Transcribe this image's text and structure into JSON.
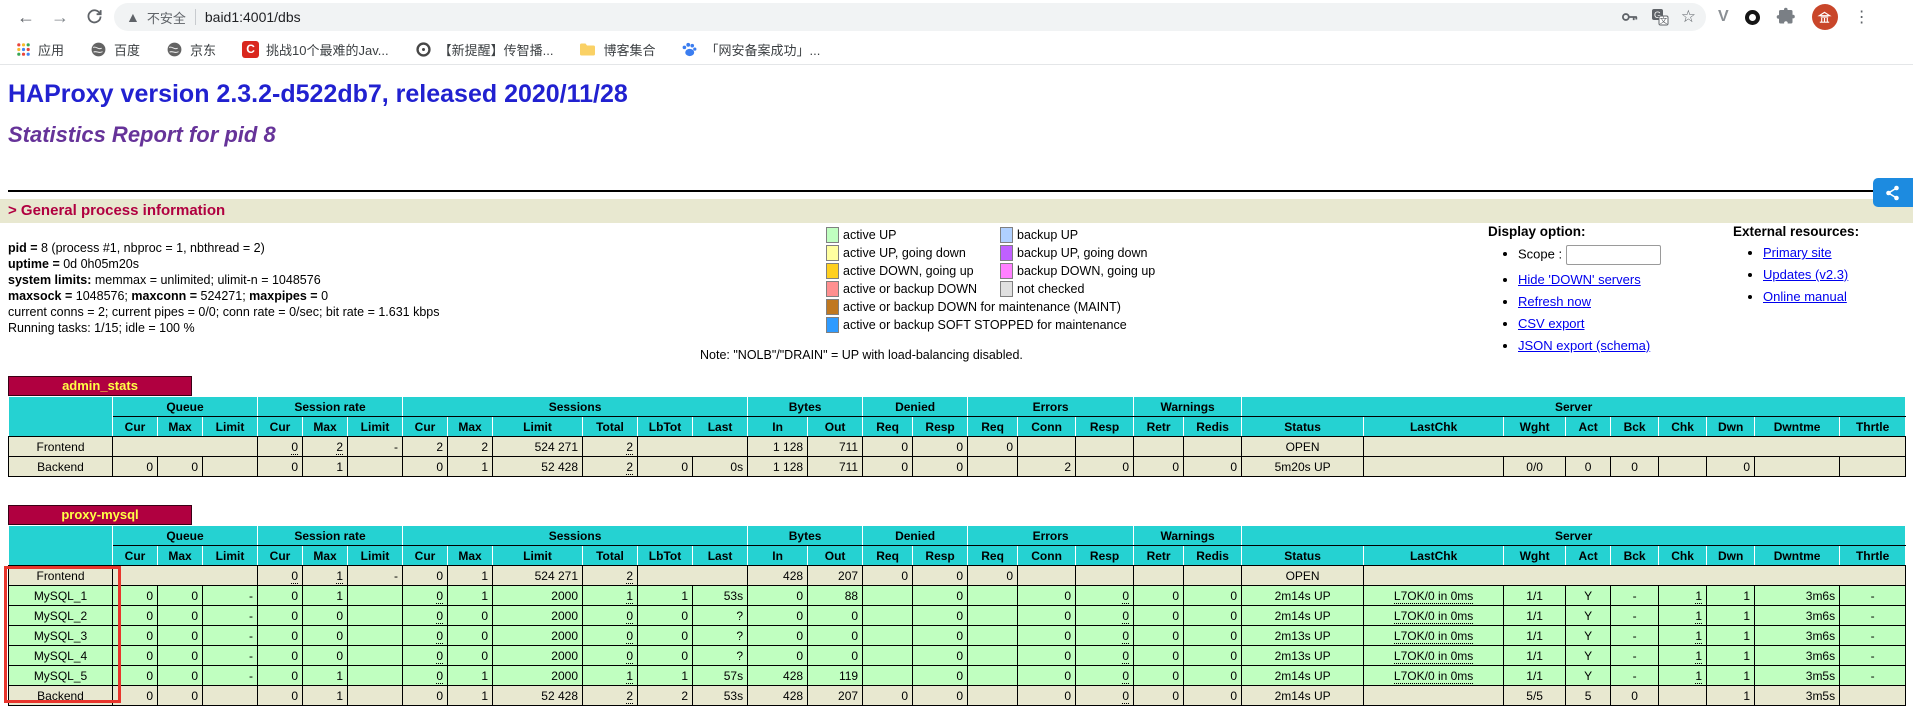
{
  "browser": {
    "security_label": "不安全",
    "url": "baid1:4001/dbs",
    "bookmarks": [
      "应用",
      "百度",
      "京东",
      "挑战10个最难的Jav...",
      "【新提醒】传智播...",
      "博客集合",
      "「网安备案成功」..."
    ]
  },
  "page": {
    "title": "HAProxy version 2.3.2-d522db7, released 2020/11/28",
    "subtitle": "Statistics Report for pid 8",
    "section_heading": "> General process information",
    "process_info": [
      [
        {
          "b": 1,
          "t": "pid = "
        },
        {
          "t": "8 (process #1, nbproc = 1, nbthread = 2)"
        }
      ],
      [
        {
          "b": 1,
          "t": "uptime = "
        },
        {
          "t": "0d 0h05m20s"
        }
      ],
      [
        {
          "b": 1,
          "t": "system limits:"
        },
        {
          "t": " memmax = unlimited; ulimit-n = 1048576"
        }
      ],
      [
        {
          "b": 1,
          "t": "maxsock = "
        },
        {
          "t": "1048576; "
        },
        {
          "b": 1,
          "t": "maxconn = "
        },
        {
          "t": "524271; "
        },
        {
          "b": 1,
          "t": "maxpipes = "
        },
        {
          "t": "0"
        }
      ],
      [
        {
          "t": "current conns = 2; current pipes = 0/0; conn rate = 0/sec; bit rate = 1.631 kbps"
        }
      ],
      [
        {
          "t": "Running tasks: 1/15; idle = 100 %"
        }
      ]
    ],
    "legend": {
      "col1": [
        {
          "label": "active UP",
          "color": "#c0ffc0"
        },
        {
          "label": "active UP, going down",
          "color": "#ffffa0"
        },
        {
          "label": "active DOWN, going up",
          "color": "#ffd020"
        },
        {
          "label": "active or backup DOWN",
          "color": "#ff9090"
        },
        {
          "label": "active or backup DOWN for maintenance (MAINT)",
          "color": "#c07820"
        },
        {
          "label": "active or backup SOFT STOPPED for maintenance",
          "color": "#2e9bff"
        }
      ],
      "col2": [
        {
          "label": "backup UP",
          "color": "#b0d0ff"
        },
        {
          "label": "backup UP, going down",
          "color": "#c060ff"
        },
        {
          "label": "backup DOWN, going up",
          "color": "#ff80ff"
        },
        {
          "label": "not checked",
          "color": "#e0e0e0"
        }
      ],
      "note": "Note: \"NOLB\"/\"DRAIN\" = UP with load-balancing disabled."
    },
    "display_options": {
      "heading": "Display option:",
      "scope_label": "Scope :",
      "scope_value": "",
      "links": [
        "Hide 'DOWN' servers",
        "Refresh now",
        "CSV export",
        "JSON export (schema)"
      ]
    },
    "external_resources": {
      "heading": "External resources:",
      "links": [
        "Primary site",
        "Updates (v2.3)",
        "Online manual"
      ]
    }
  },
  "stats_tables": [
    {
      "title": "admin_stats",
      "groups": [
        {
          "label": "Queue",
          "span": 3
        },
        {
          "label": "Session rate",
          "span": 3
        },
        {
          "label": "Sessions",
          "span": 6
        },
        {
          "label": "Bytes",
          "span": 2
        },
        {
          "label": "Denied",
          "span": 2
        },
        {
          "label": "Errors",
          "span": 3
        },
        {
          "label": "Warnings",
          "span": 2
        },
        {
          "label": "Server",
          "span": 9
        }
      ],
      "columns": [
        "Cur",
        "Max",
        "Limit",
        "Cur",
        "Max",
        "Limit",
        "Cur",
        "Max",
        "Limit",
        "Total",
        "LbTot",
        "Last",
        "In",
        "Out",
        "Req",
        "Resp",
        "Req",
        "Conn",
        "Resp",
        "Retr",
        "Redis",
        "Status",
        "LastChk",
        "Wght",
        "Act",
        "Bck",
        "Chk",
        "Dwn",
        "Dwntme",
        "Thrtle"
      ],
      "rows": [
        {
          "name": "Frontend",
          "cls": "frontend",
          "dotted": [
            1,
            2,
            7
          ],
          "cells": [
            {
              "v": "",
              "span": 3
            },
            "0",
            "2",
            "-",
            "2",
            "2",
            "524 271",
            "2",
            {
              "v": "",
              "span": 2
            },
            "1 128",
            "711",
            "0",
            "0",
            "0",
            "",
            "",
            "",
            "",
            "OPEN",
            {
              "v": "",
              "span": 8
            }
          ]
        },
        {
          "name": "Backend",
          "cls": "backend",
          "dotted": [
            9
          ],
          "cells": [
            "0",
            "0",
            "",
            "0",
            "1",
            "",
            "0",
            "1",
            "52 428",
            "2",
            "0",
            "0s",
            "1 128",
            "711",
            "0",
            "0",
            "",
            "2",
            "0",
            "0",
            "0",
            "5m20s UP",
            "",
            "0/0",
            "0",
            "0",
            "",
            "0",
            "",
            ""
          ]
        }
      ]
    },
    {
      "title": "proxy-mysql",
      "groups": [
        {
          "label": "Queue",
          "span": 3
        },
        {
          "label": "Session rate",
          "span": 3
        },
        {
          "label": "Sessions",
          "span": 6
        },
        {
          "label": "Bytes",
          "span": 2
        },
        {
          "label": "Denied",
          "span": 2
        },
        {
          "label": "Errors",
          "span": 3
        },
        {
          "label": "Warnings",
          "span": 2
        },
        {
          "label": "Server",
          "span": 9
        }
      ],
      "columns": [
        "Cur",
        "Max",
        "Limit",
        "Cur",
        "Max",
        "Limit",
        "Cur",
        "Max",
        "Limit",
        "Total",
        "LbTot",
        "Last",
        "In",
        "Out",
        "Req",
        "Resp",
        "Req",
        "Conn",
        "Resp",
        "Retr",
        "Redis",
        "Status",
        "LastChk",
        "Wght",
        "Act",
        "Bck",
        "Chk",
        "Dwn",
        "Dwntme",
        "Thrtle"
      ],
      "rows": [
        {
          "name": "Frontend",
          "cls": "frontend",
          "dotted": [
            1,
            2,
            7
          ],
          "cells": [
            {
              "v": "",
              "span": 3
            },
            "0",
            "1",
            "-",
            "0",
            "1",
            "524 271",
            "2",
            {
              "v": "",
              "span": 2
            },
            "428",
            "207",
            "0",
            "0",
            "0",
            "",
            "",
            "",
            "",
            "OPEN",
            {
              "v": "",
              "span": 8
            }
          ]
        },
        {
          "name": "MySQL_1",
          "cls": "up",
          "dotted": [
            6,
            9,
            18,
            22,
            26
          ],
          "cells": [
            "0",
            "0",
            "-",
            "0",
            "1",
            "",
            "0",
            "1",
            "2000",
            "1",
            "1",
            "53s",
            "0",
            "88",
            "",
            "0",
            "",
            "0",
            "0",
            "0",
            "0",
            "2m14s UP",
            "L7OK/0 in 0ms",
            "1/1",
            "Y",
            "-",
            "1",
            "1",
            "3m6s",
            "-"
          ]
        },
        {
          "name": "MySQL_2",
          "cls": "up",
          "dotted": [
            6,
            9,
            18,
            22,
            26
          ],
          "cells": [
            "0",
            "0",
            "-",
            "0",
            "0",
            "",
            "0",
            "0",
            "2000",
            "0",
            "0",
            "?",
            "0",
            "0",
            "",
            "0",
            "",
            "0",
            "0",
            "0",
            "0",
            "2m14s UP",
            "L7OK/0 in 0ms",
            "1/1",
            "Y",
            "-",
            "1",
            "1",
            "3m6s",
            "-"
          ]
        },
        {
          "name": "MySQL_3",
          "cls": "up",
          "dotted": [
            6,
            9,
            18,
            22,
            26
          ],
          "cells": [
            "0",
            "0",
            "-",
            "0",
            "0",
            "",
            "0",
            "0",
            "2000",
            "0",
            "0",
            "?",
            "0",
            "0",
            "",
            "0",
            "",
            "0",
            "0",
            "0",
            "0",
            "2m13s UP",
            "L7OK/0 in 0ms",
            "1/1",
            "Y",
            "-",
            "1",
            "1",
            "3m6s",
            "-"
          ]
        },
        {
          "name": "MySQL_4",
          "cls": "up",
          "dotted": [
            6,
            9,
            18,
            22,
            26
          ],
          "cells": [
            "0",
            "0",
            "-",
            "0",
            "0",
            "",
            "0",
            "0",
            "2000",
            "0",
            "0",
            "?",
            "0",
            "0",
            "",
            "0",
            "",
            "0",
            "0",
            "0",
            "0",
            "2m13s UP",
            "L7OK/0 in 0ms",
            "1/1",
            "Y",
            "-",
            "1",
            "1",
            "3m6s",
            "-"
          ]
        },
        {
          "name": "MySQL_5",
          "cls": "up",
          "dotted": [
            6,
            9,
            18,
            22,
            26
          ],
          "cells": [
            "0",
            "0",
            "-",
            "0",
            "1",
            "",
            "0",
            "1",
            "2000",
            "1",
            "1",
            "57s",
            "428",
            "119",
            "",
            "0",
            "",
            "0",
            "0",
            "0",
            "0",
            "2m14s UP",
            "L7OK/0 in 0ms",
            "1/1",
            "Y",
            "-",
            "1",
            "1",
            "3m5s",
            "-"
          ]
        },
        {
          "name": "Backend",
          "cls": "backend",
          "dotted": [
            9,
            18
          ],
          "cells": [
            "0",
            "0",
            "",
            "0",
            "1",
            "",
            "0",
            "1",
            "52 428",
            "2",
            "2",
            "53s",
            "428",
            "207",
            "0",
            "0",
            "",
            "0",
            "0",
            "0",
            "0",
            "2m14s UP",
            "",
            "5/5",
            "5",
            "0",
            "",
            "1",
            "3m5s",
            ""
          ]
        }
      ]
    }
  ]
}
